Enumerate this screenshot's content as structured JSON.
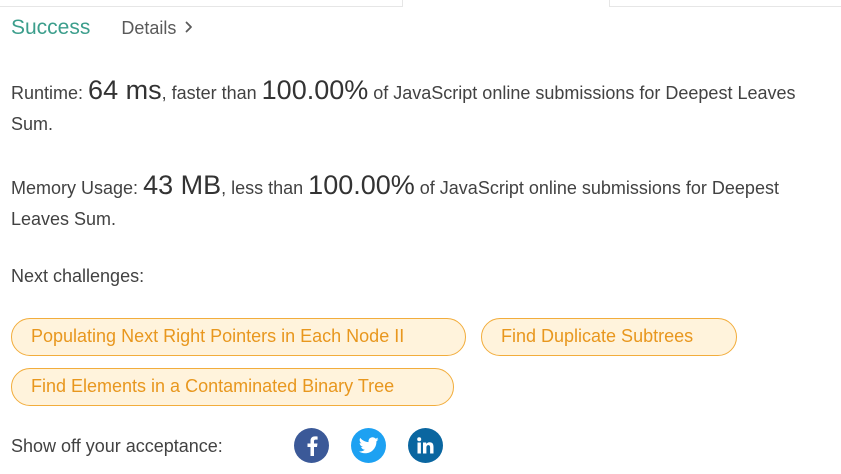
{
  "status": {
    "result": "Success",
    "details_label": "Details",
    "result_color": "#3c9e8c"
  },
  "runtime": {
    "label": "Runtime:",
    "value": "64 ms",
    "comparison": ", faster than",
    "percent": "100.00%",
    "suffix": "of JavaScript online submissions for Deepest Leaves Sum."
  },
  "memory": {
    "label": "Memory Usage:",
    "value": "43 MB",
    "comparison": ", less than",
    "percent": "100.00%",
    "suffix": "of JavaScript online submissions for Deepest Leaves Sum."
  },
  "next": {
    "label": "Next challenges:",
    "challenges": [
      {
        "title": "Populating Next Right Pointers in Each Node II"
      },
      {
        "title": "Find Duplicate Subtrees"
      },
      {
        "title": "Find Elements in a Contaminated Binary Tree"
      }
    ],
    "chip_color": "#f2ad3c"
  },
  "share": {
    "label": "Show off your acceptance:",
    "networks": [
      {
        "icon": "facebook-icon",
        "color": "#3b5998"
      },
      {
        "icon": "twitter-icon",
        "color": "#1da1f2"
      },
      {
        "icon": "linkedin-icon",
        "color": "#0a66a0"
      }
    ]
  }
}
